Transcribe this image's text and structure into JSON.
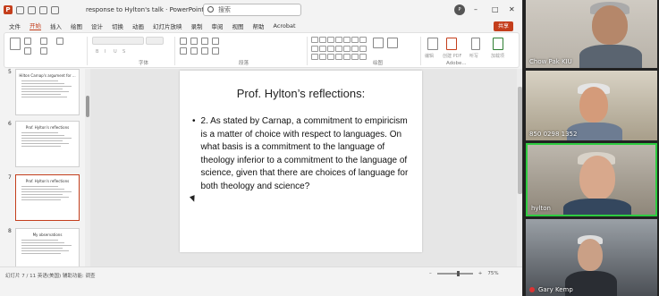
{
  "window": {
    "title": "response to Hylton's talk  ·  PowerPoint",
    "search_placeholder": "搜索",
    "user_initials": "P",
    "share_label": "共享"
  },
  "menu": [
    "文件",
    "开始",
    "插入",
    "绘图",
    "设计",
    "切换",
    "动画",
    "幻灯片放映",
    "录制",
    "审阅",
    "视图",
    "帮助",
    "Acrobat"
  ],
  "ribbon": {
    "groups": [
      "字体",
      "段落",
      "绘图",
      "Adobe..."
    ],
    "right_labels": [
      "编辑",
      "创建 PDF",
      "听写",
      "加载项"
    ]
  },
  "thumbnails": [
    {
      "num": "5",
      "title": "Hilton Carnap's argument for ...",
      "lines": 7
    },
    {
      "num": "6",
      "title": "Prof. Hylton's reflections",
      "lines": 6
    },
    {
      "num": "7",
      "title": "Prof. Hylton's reflections",
      "lines": 6
    },
    {
      "num": "8",
      "title": "My observations",
      "lines": 6
    }
  ],
  "slide": {
    "title": "Prof. Hylton’s reflections:",
    "bullet": "2. As stated by Carnap, a commitment to empiricism is a matter of choice with respect to languages. On what basis is a commitment to the language of theology inferior to a commitment to the language of science, given that there are choices of language for both theology and science?"
  },
  "statusbar": {
    "left": "幻灯片 7 / 11   英语(美国)   辅助功能: 调查",
    "zoom": "75%"
  },
  "participants": [
    {
      "name": "Chow Pak KIU"
    },
    {
      "name": "850 0298 1352"
    },
    {
      "name": "hylton"
    },
    {
      "name": "Gary Kemp"
    }
  ]
}
